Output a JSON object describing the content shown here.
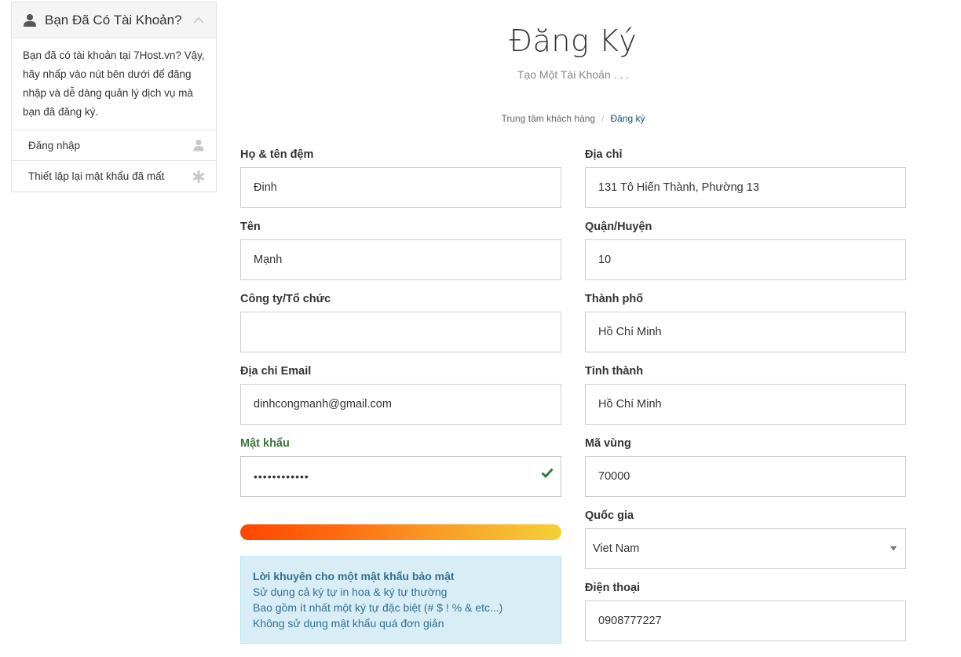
{
  "sidebar": {
    "title": "Bạn Đã Có Tài Khoản?",
    "body": "Bạn đã có tài khoản tại 7Host.vn? Vậy, hãy nhấp vào nút bên dưới để đăng nhập và dễ dàng quản lý dịch vụ mà bạn đã đăng ký.",
    "links": [
      {
        "label": "Đăng nhập",
        "icon": "user-icon"
      },
      {
        "label": "Thiết lập lại mật khẩu đã mất",
        "icon": "asterisk-icon"
      }
    ]
  },
  "header": {
    "title": "Đăng Ký",
    "subtitle": "Tạo Một Tài Khoản . . .",
    "breadcrumb": [
      "Trung tâm khách hàng",
      "Đăng ký"
    ]
  },
  "form": {
    "first_name": {
      "label": "Họ & tên đệm",
      "value": "Đinh"
    },
    "last_name": {
      "label": "Tên",
      "value": "Mạnh"
    },
    "company": {
      "label": "Công ty/Tổ chức",
      "value": ""
    },
    "email": {
      "label": "Địa chỉ Email",
      "value": "dinhcongmanh@gmail.com"
    },
    "password": {
      "label": "Mật khẩu",
      "value": "••••••••••••"
    },
    "address": {
      "label": "Địa chỉ",
      "value": "131 Tô Hiến Thành, Phường 13"
    },
    "district": {
      "label": "Quận/Huyện",
      "value": "10"
    },
    "city": {
      "label": "Thành phố",
      "value": "Hồ Chí Minh"
    },
    "province": {
      "label": "Tỉnh thành",
      "value": "Hồ Chí Minh"
    },
    "postcode": {
      "label": "Mã vùng",
      "value": "70000"
    },
    "country": {
      "label": "Quốc gia",
      "value": "Viet Nam"
    },
    "phone": {
      "label": "Điện thoại",
      "value": "0908777227"
    }
  },
  "password_strength": 1.0,
  "tips": {
    "title": "Lời khuyên cho một mật khẩu bảo mật",
    "items": [
      "Sử dụng cả ký tự in hoa & ký tự thường",
      "Bao gồm ít nhất một ký tự đặc biệt (# $ ! % & etc...)",
      "Không sử dụng mật khẩu quá đơn giản"
    ]
  },
  "colors": {
    "success": "#3c763d",
    "info_bg": "#d9edf7",
    "info_text": "#31708f",
    "link": "#1b4b7a"
  }
}
